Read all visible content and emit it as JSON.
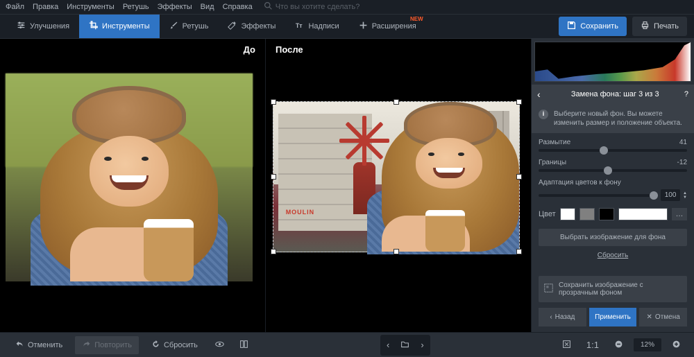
{
  "menubar": [
    "Файл",
    "Правка",
    "Инструменты",
    "Ретушь",
    "Эффекты",
    "Вид",
    "Справка"
  ],
  "search_placeholder": "Что вы хотите сделать?",
  "tabs": [
    {
      "label": "Улучшения",
      "icon": "sliders"
    },
    {
      "label": "Инструменты",
      "icon": "crop",
      "active": true
    },
    {
      "label": "Ретушь",
      "icon": "brush"
    },
    {
      "label": "Эффекты",
      "icon": "wand"
    },
    {
      "label": "Надписи",
      "icon": "text"
    },
    {
      "label": "Расширения",
      "icon": "plus",
      "badge": "NEW"
    }
  ],
  "toolbar": {
    "save": "Сохранить",
    "print": "Печать"
  },
  "canvas": {
    "before": "До",
    "after": "После",
    "moulin": "MOULIN"
  },
  "panel": {
    "title": "Замена фона: шаг 3 из 3",
    "info": "Выберите новый фон. Вы можете изменить размер и положение объекта.",
    "blur": {
      "label": "Размытие",
      "value": "41",
      "pos": 41
    },
    "edges": {
      "label": "Границы",
      "value": "-12",
      "pos": 44
    },
    "adapt_label": "Адаптация цветов к фону",
    "adapt_value": "100",
    "color_label": "Цвет",
    "swatches": [
      "#ffffff",
      "#808080",
      "#000000"
    ],
    "choose_bg": "Выбрать изображение для фона",
    "reset": "Сбросить",
    "save_transparent": "Сохранить изображение с прозрачным фоном",
    "back": "Назад",
    "apply": "Применить",
    "cancel": "Отмена"
  },
  "statusbar": {
    "undo": "Отменить",
    "redo": "Повторить",
    "reset": "Сбросить",
    "ratio": "1:1",
    "zoom": "12%"
  }
}
